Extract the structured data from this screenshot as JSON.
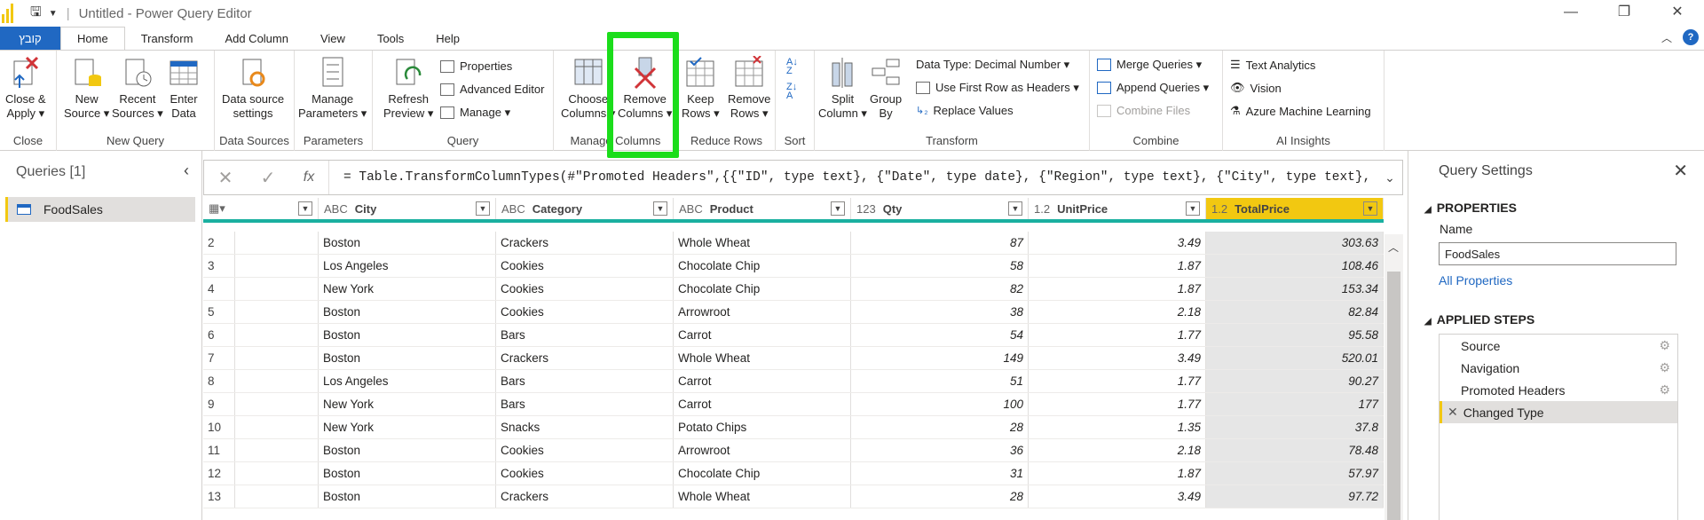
{
  "window": {
    "title": "Untitled - Power Query Editor",
    "sep": "|"
  },
  "tabs": {
    "file": "קובץ",
    "items": [
      "Home",
      "Transform",
      "Add Column",
      "View",
      "Tools",
      "Help"
    ]
  },
  "ribbon": {
    "close": {
      "label1": "Close &",
      "label2": "Apply ▾",
      "group": "Close"
    },
    "new_query": {
      "new_source1": "New",
      "new_source2": "Source ▾",
      "recent1": "Recent",
      "recent2": "Sources ▾",
      "enter1": "Enter",
      "enter2": "Data",
      "group": "New Query"
    },
    "data_sources": {
      "label1": "Data source",
      "label2": "settings",
      "group": "Data Sources"
    },
    "parameters": {
      "label1": "Manage",
      "label2": "Parameters ▾",
      "group": "Parameters"
    },
    "query": {
      "refresh1": "Refresh",
      "refresh2": "Preview ▾",
      "properties": "Properties",
      "advanced": "Advanced Editor",
      "manage": "Manage ▾",
      "group": "Query"
    },
    "manage_columns": {
      "choose1": "Choose",
      "choose2": "Columns ▾",
      "remove1": "Remove",
      "remove2": "Columns ▾",
      "group": "Manage Columns"
    },
    "reduce_rows": {
      "keep1": "Keep",
      "keep2": "Rows ▾",
      "remove1": "Remove",
      "remove2": "Rows ▾",
      "group": "Reduce Rows"
    },
    "sort": {
      "group": "Sort"
    },
    "transform": {
      "split1": "Split",
      "split2": "Column ▾",
      "group1": "Group",
      "group2": "By",
      "data_type": "Data Type: Decimal Number ▾",
      "first_row": "Use First Row as Headers ▾",
      "replace": "Replace Values",
      "group": "Transform"
    },
    "combine": {
      "merge": "Merge Queries ▾",
      "append": "Append Queries ▾",
      "combine_files": "Combine Files",
      "group": "Combine"
    },
    "ai": {
      "text": "Text Analytics",
      "vision": "Vision",
      "aml": "Azure Machine Learning",
      "group": "AI Insights"
    }
  },
  "queries": {
    "header": "Queries [1]",
    "items": [
      "FoodSales"
    ]
  },
  "formula": "= Table.TransformColumnTypes(#\"Promoted Headers\",{{\"ID\", type text}, {\"Date\", type date}, {\"Region\", type text}, {\"City\", type text},",
  "grid": {
    "columns": [
      {
        "type": "",
        "name": ""
      },
      {
        "type": "ABC",
        "name": "City"
      },
      {
        "type": "ABC",
        "name": "Category"
      },
      {
        "type": "ABC",
        "name": "Product"
      },
      {
        "type": "123",
        "name": "Qty"
      },
      {
        "type": "1.2",
        "name": "UnitPrice"
      },
      {
        "type": "1.2",
        "name": "TotalPrice"
      }
    ],
    "rows": [
      [
        "2",
        "Boston",
        "Crackers",
        "Whole Wheat",
        "87",
        "3.49",
        "303.63"
      ],
      [
        "3",
        "Los Angeles",
        "Cookies",
        "Chocolate Chip",
        "58",
        "1.87",
        "108.46"
      ],
      [
        "4",
        "New York",
        "Cookies",
        "Chocolate Chip",
        "82",
        "1.87",
        "153.34"
      ],
      [
        "5",
        "Boston",
        "Cookies",
        "Arrowroot",
        "38",
        "2.18",
        "82.84"
      ],
      [
        "6",
        "Boston",
        "Bars",
        "Carrot",
        "54",
        "1.77",
        "95.58"
      ],
      [
        "7",
        "Boston",
        "Crackers",
        "Whole Wheat",
        "149",
        "3.49",
        "520.01"
      ],
      [
        "8",
        "Los Angeles",
        "Bars",
        "Carrot",
        "51",
        "1.77",
        "90.27"
      ],
      [
        "9",
        "New York",
        "Bars",
        "Carrot",
        "100",
        "1.77",
        "177"
      ],
      [
        "10",
        "New York",
        "Snacks",
        "Potato Chips",
        "28",
        "1.35",
        "37.8"
      ],
      [
        "11",
        "Boston",
        "Cookies",
        "Arrowroot",
        "36",
        "2.18",
        "78.48"
      ],
      [
        "12",
        "Boston",
        "Cookies",
        "Chocolate Chip",
        "31",
        "1.87",
        "57.97"
      ],
      [
        "13",
        "Boston",
        "Crackers",
        "Whole Wheat",
        "28",
        "3.49",
        "97.72"
      ]
    ]
  },
  "settings": {
    "title": "Query Settings",
    "properties": "PROPERTIES",
    "name_label": "Name",
    "name_value": "FoodSales",
    "all_properties": "All Properties",
    "applied_steps": "APPLIED STEPS",
    "steps": [
      "Source",
      "Navigation",
      "Promoted Headers",
      "Changed Type"
    ]
  },
  "colors": {
    "accent": "#f2c811",
    "file_tab": "#2068c2",
    "highlight": "#1bdd1b",
    "teal": "#1ab0a0"
  }
}
